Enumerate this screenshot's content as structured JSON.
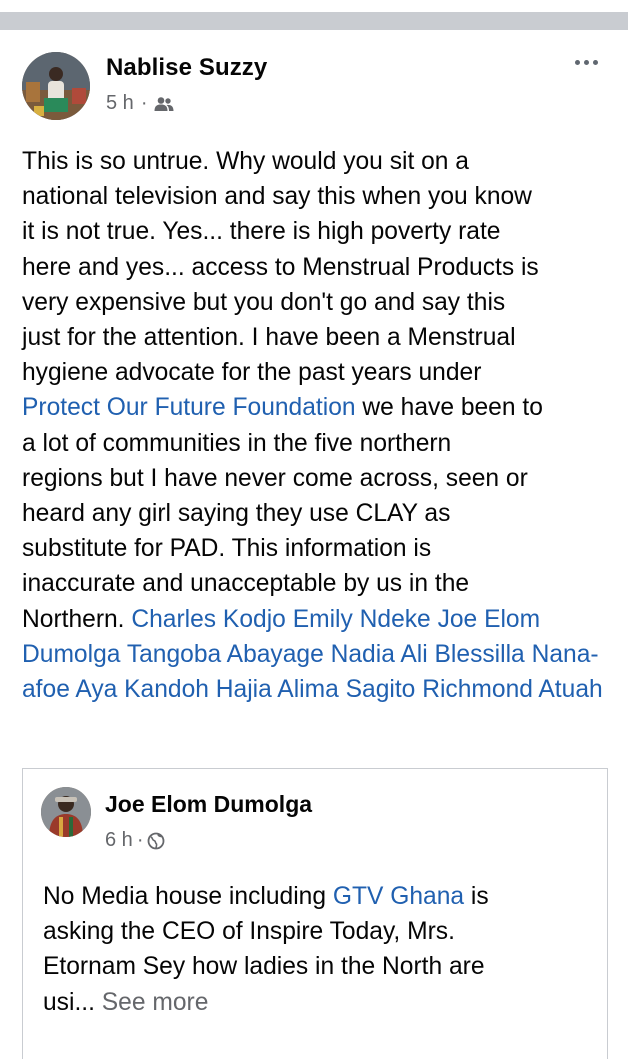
{
  "post": {
    "author": "Nablise Suzzy",
    "time": "5 h",
    "separator": "·",
    "audience_icon": "friends-icon",
    "more_icon": "more-options-icon",
    "text": {
      "line1": "This is so untrue. Why would you sit on a",
      "line2": "national television and say this when you know",
      "line3": "it is not true. Yes... there is high poverty rate",
      "line4": "here and yes... access to Menstrual Products is",
      "line5": "very expensive but you don't go and say this",
      "line6": "just for the attention. I have been a Menstrual",
      "line7": "hygiene advocate for the past years under",
      "link_foundation": "Protect Our Future Foundation",
      "after_foundation": " we have been to",
      "line9": "a lot of communities in the five northern",
      "line10": "regions but I have never come across, seen or",
      "line11": "heard any girl saying they use CLAY as",
      "line12": "substitute for PAD. This information is",
      "line13": "inaccurate and unacceptable by us in the",
      "before_tags": "Northern. "
    },
    "tags": [
      "Charles Kodjo",
      "Emily Ndeke",
      "Joe Elom Dumolga",
      "Tangoba Abayage",
      "Nadia Ali",
      "Blessilla Nana-afoe",
      "Aya Kandoh",
      "Hajia Alima Sagito",
      "Richmond Atuah"
    ]
  },
  "shared_post": {
    "author": "Joe Elom Dumolga",
    "time": "6 h",
    "separator": "·",
    "audience_icon": "globe-icon",
    "text": {
      "prefix": "No Media house including ",
      "link": "GTV Ghana",
      "suffix_line1": " is",
      "line2": "asking the CEO of Inspire Today, Mrs.",
      "line3": "Etornam Sey how ladies in the North are",
      "truncated": "usi... ",
      "see_more": "See more"
    }
  },
  "colors": {
    "link": "#2060b0",
    "meta": "#65676b",
    "divider": "#c9ccd1"
  }
}
